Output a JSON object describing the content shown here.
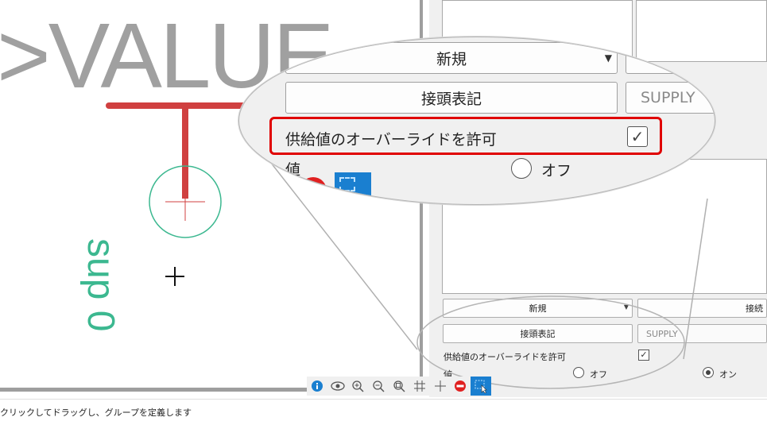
{
  "canvas": {
    "value_text": ">VALUE",
    "sup_text": "sup 0",
    "colors": {
      "wire": "#d04040",
      "sup": "#3cb890",
      "value": "#a0a0a0"
    }
  },
  "panel": {
    "new_combo": "新規",
    "connect_button": "接続",
    "prefix_button": "接頭表記",
    "supply_field": "SUPPLY",
    "override_label": "供給値のオーバーライドを許可",
    "override_checked": "✓",
    "value_label": "値",
    "radio_off": "オフ",
    "radio_on": "オン"
  },
  "toolbar": {
    "icons": [
      "info-icon",
      "eye-icon",
      "zoom-in-icon",
      "zoom-out-icon",
      "zoom-fit-icon",
      "grid-icon",
      "crosshair-icon",
      "no-entry-icon",
      "select-cursor-icon"
    ]
  },
  "status": {
    "message": "クリックしてドラッグし、グループを定義します"
  },
  "accent": "#1a7fd0",
  "highlight": "#e00000"
}
